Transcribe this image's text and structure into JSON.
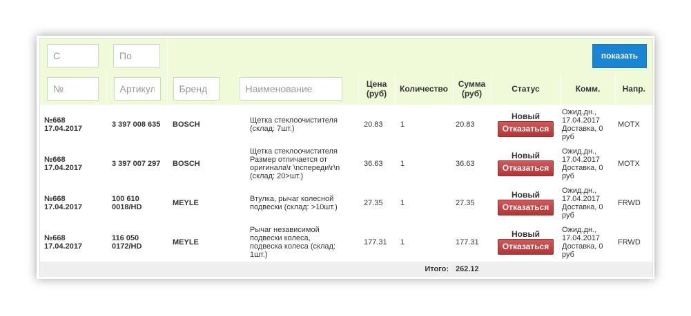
{
  "filters": {
    "date_from_placeholder": "С",
    "date_to_placeholder": "По",
    "show_button": "показать",
    "number_placeholder": "№",
    "article_placeholder": "Артикул",
    "brand_placeholder": "Бренд",
    "name_placeholder": "Наименование"
  },
  "headers": {
    "price": "Цена (руб)",
    "quantity": "Количество",
    "sum": "Сумма (руб)",
    "status": "Статус",
    "comment": "Комм.",
    "direction": "Напр."
  },
  "rows": [
    {
      "number": "№668",
      "date": "17.04.2017",
      "article": "3 397 008 635",
      "brand": "BOSCH",
      "name": "Щетка стеклоочистителя (склад: 7шт.)",
      "price": "20.83",
      "quantity": "1",
      "sum": "20.83",
      "status": "Новый",
      "cancel_label": "Отказаться",
      "comment": "Ожид.дн., 17.04.2017 Доставка, 0 руб",
      "direction": "MOTX"
    },
    {
      "number": "№668",
      "date": "17.04.2017",
      "article": "3 397 007 297",
      "brand": "BOSCH",
      "name": "Щетка стеклоочистителя Размер отличается от оригинала\\r \\nспереди\\r\\n (склад: 20>шт.)",
      "price": "36.63",
      "quantity": "1",
      "sum": "36.63",
      "status": "Новый",
      "cancel_label": "Отказаться",
      "comment": "Ожид.дн., 17.04.2017 Доставка, 0 руб",
      "direction": "MOTX"
    },
    {
      "number": "№668",
      "date": "17.04.2017",
      "article": "100 610 0018/HD",
      "brand": "MEYLE",
      "name": "Втулка, рычаг колесной подвески (склад: >10шт.)",
      "price": "27.35",
      "quantity": "1",
      "sum": "27.35",
      "status": "Новый",
      "cancel_label": "Отказаться",
      "comment": "Ожид.дн., 17.04.2017 Доставка, 0 руб",
      "direction": "FRWD"
    },
    {
      "number": "№668",
      "date": "17.04.2017",
      "article": "116 050 0172/HD",
      "brand": "MEYLE",
      "name": "Рычаг независимой подвески колеса, подвеска колеса (склад: 1шт.)",
      "price": "177.31",
      "quantity": "1",
      "sum": "177.31",
      "status": "Новый",
      "cancel_label": "Отказаться",
      "comment": "Ожид.дн., 17.04.2017 Доставка, 0 руб",
      "direction": "FRWD"
    }
  ],
  "footer": {
    "total_label": "Итого:",
    "total_value": "262.12"
  }
}
